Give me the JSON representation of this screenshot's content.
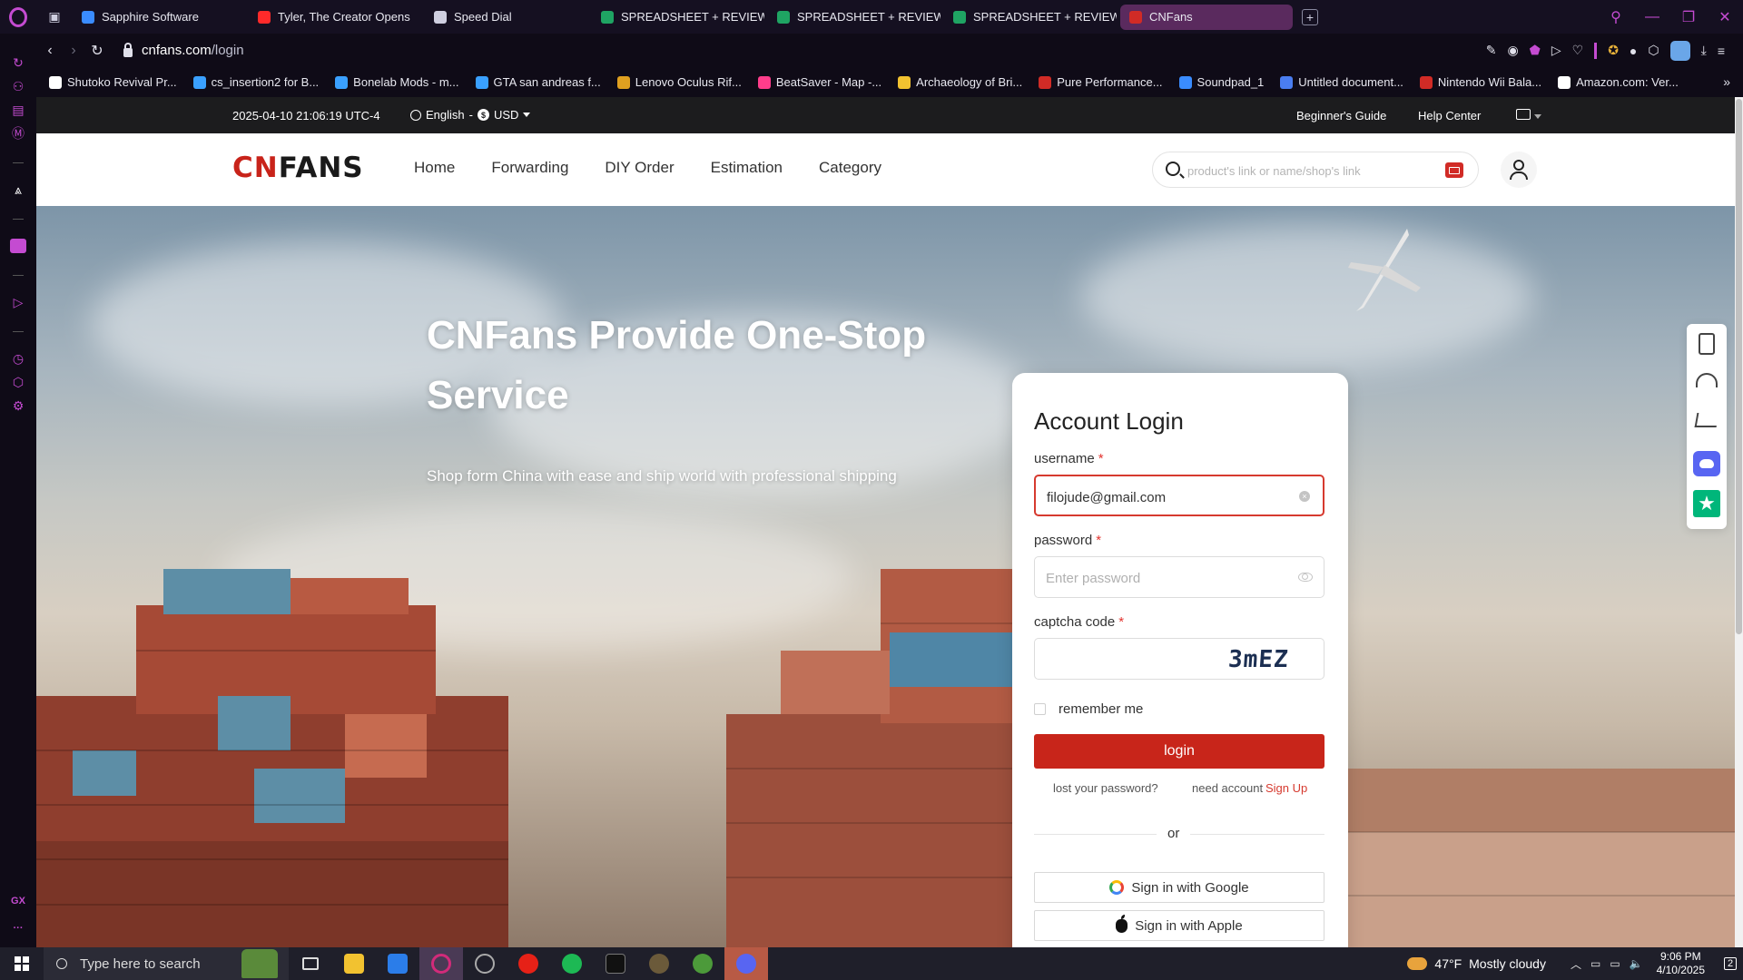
{
  "browser": {
    "tabs": [
      {
        "label": "Sapphire Software",
        "color": "#3a8cff"
      },
      {
        "label": "Tyler, The Creator Opens",
        "color": "#ff2a2a"
      },
      {
        "label": "Speed Dial",
        "color": "#cfcfe0"
      },
      {
        "label": "SPREADSHEET + REVIEW",
        "color": "#1fa463"
      },
      {
        "label": "SPREADSHEET + REVIEW",
        "color": "#1fa463"
      },
      {
        "label": "SPREADSHEET + REVIEW",
        "color": "#1fa463"
      },
      {
        "label": "CNFans",
        "color": "#d12b26",
        "active": true
      }
    ],
    "new_tab": "+",
    "address": {
      "host": "cnfans.com",
      "path": "/login"
    },
    "bookmarks": [
      {
        "label": "Shutoko Revival Pr...",
        "color": "#ffffff"
      },
      {
        "label": "cs_insertion2 for B...",
        "color": "#3aa0ff"
      },
      {
        "label": "Bonelab Mods - m...",
        "color": "#3aa0ff"
      },
      {
        "label": "GTA san andreas f...",
        "color": "#3aa0ff"
      },
      {
        "label": "Lenovo Oculus Rif...",
        "color": "#e0a020"
      },
      {
        "label": "BeatSaver - Map -...",
        "color": "#ff3d8b"
      },
      {
        "label": "Archaeology of Bri...",
        "color": "#f2c230"
      },
      {
        "label": "Pure Performance...",
        "color": "#d12b26"
      },
      {
        "label": "Soundpad_1",
        "color": "#3a8cff"
      },
      {
        "label": "Untitled document...",
        "color": "#4a7df0"
      },
      {
        "label": "Nintendo Wii Bala...",
        "color": "#d12b26"
      },
      {
        "label": "Amazon.com: Ver...",
        "color": "#ffffff"
      }
    ],
    "bookmarks_more": "»",
    "accent": "#c44bd1"
  },
  "site": {
    "topbar": {
      "datetime": "2025-04-10 21:06:19 UTC-4",
      "language": "English",
      "separator": "-",
      "currency": "USD",
      "beginners_guide": "Beginner's Guide",
      "help_center": "Help Center"
    },
    "logo": {
      "part1": "CN",
      "part2": "FANS"
    },
    "nav": [
      "Home",
      "Forwarding",
      "DIY Order",
      "Estimation",
      "Category"
    ],
    "search_placeholder": "product's link or name/shop's link",
    "hero": {
      "title": "CNFans Provide One-Stop Service",
      "subtitle": "Shop form China with ease and ship world with professional shipping"
    },
    "login": {
      "title": "Account Login",
      "username_label": "username",
      "username_value": "filojude@gmail.com",
      "password_label": "password",
      "password_placeholder": "Enter password",
      "captcha_label": "captcha code",
      "captcha_value": "",
      "captcha_image_text": "3mEZ",
      "required_mark": "*",
      "remember_me": "remember me",
      "login_button": "login",
      "lost_password": "lost your password?",
      "need_account": "need account",
      "sign_up": "Sign Up",
      "or": "or",
      "google": "Sign in with Google",
      "apple": "Sign in with Apple",
      "brand_red": "#c8251a"
    }
  },
  "taskbar": {
    "search_placeholder": "Type here to search",
    "weather": {
      "temp": "47°F",
      "condition": "Mostly cloudy"
    },
    "time": "9:06 PM",
    "date": "4/10/2025",
    "notifications": "2"
  }
}
